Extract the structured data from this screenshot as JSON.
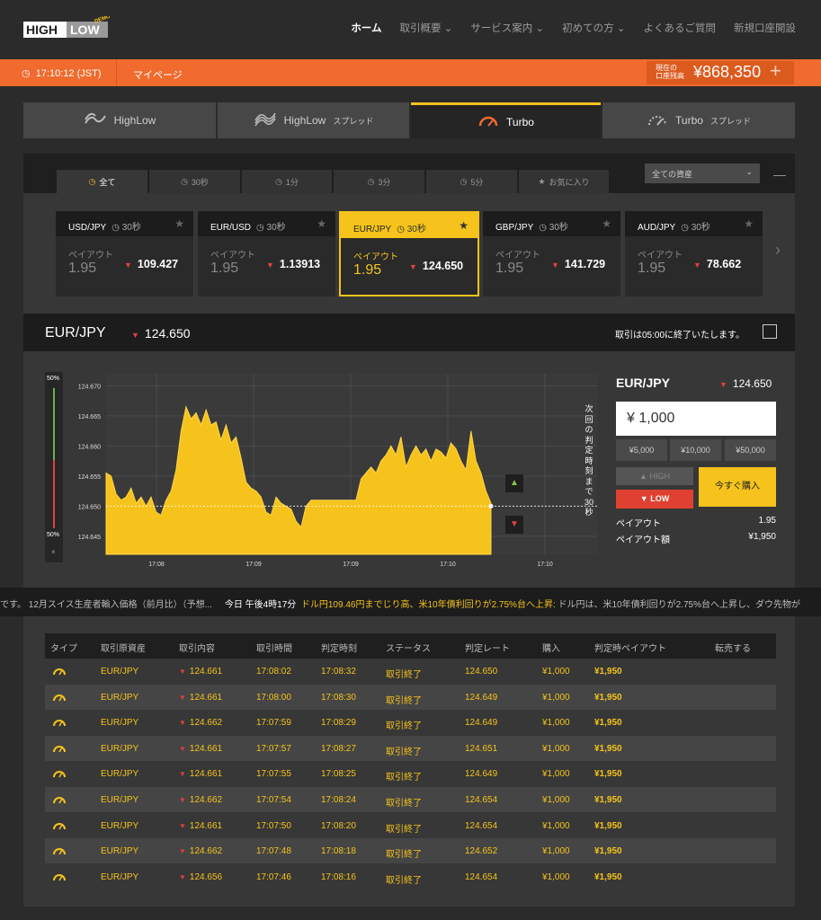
{
  "header": {
    "logo_text_1": "HIGH",
    "logo_text_2": "LOW",
    "logo_badge": "DEMO",
    "nav": [
      "ホーム",
      "取引概要",
      "サービス案内",
      "初めての方",
      "よくあるご質問",
      "新規口座開設"
    ]
  },
  "statusbar": {
    "clock": "17:10:12 (JST)",
    "mypage": "マイページ",
    "balance_label_1": "現在の",
    "balance_label_2": "口座残高",
    "balance": "¥868,350",
    "plus": "+"
  },
  "tabs": [
    {
      "label": "HighLow",
      "sub": ""
    },
    {
      "label": "HighLow",
      "sub": "スプレッド"
    },
    {
      "label": "Turbo",
      "sub": ""
    },
    {
      "label": "Turbo",
      "sub": "スプレッド"
    }
  ],
  "filters": [
    "全て",
    "30秒",
    "1分",
    "3分",
    "5分",
    "お気に入り"
  ],
  "asset_select": "全ての資産",
  "cards": [
    {
      "pair": "USD/JPY",
      "dur": "30秒",
      "payout_label": "ペイアウト",
      "payout": "1.95",
      "rate": "109.427"
    },
    {
      "pair": "EUR/USD",
      "dur": "30秒",
      "payout_label": "ペイアウト",
      "payout": "1.95",
      "rate": "1.13913"
    },
    {
      "pair": "EUR/JPY",
      "dur": "30秒",
      "payout_label": "ペイアウト",
      "payout": "1.95",
      "rate": "124.650"
    },
    {
      "pair": "GBP/JPY",
      "dur": "30秒",
      "payout_label": "ペイアウト",
      "payout": "1.95",
      "rate": "141.729"
    },
    {
      "pair": "AUD/JPY",
      "dur": "30秒",
      "payout_label": "ペイアウト",
      "payout": "1.95",
      "rate": "78.662"
    }
  ],
  "pairbar": {
    "pair": "EUR/JPY",
    "rate": "124.650",
    "close_msg": "取引は05:00に終了いたします。"
  },
  "gauge": {
    "top": "50%",
    "bottom": "50%",
    "x": "×"
  },
  "countdown": "次回の判定時刻まで30秒",
  "chart_data": {
    "type": "area",
    "x_ticks": [
      "17:08",
      "17:09",
      "17:09",
      "17:10",
      "17:10"
    ],
    "y_ticks": [
      "124.670",
      "124.665",
      "124.660",
      "124.655",
      "124.650",
      "124.645"
    ],
    "ylim": [
      124.642,
      124.672
    ],
    "current": 124.65,
    "color": "#f5c31b",
    "values": [
      124.6555,
      124.655,
      124.652,
      124.651,
      124.6515,
      124.653,
      124.6505,
      124.6515,
      124.65,
      124.6515,
      124.649,
      124.6485,
      124.651,
      124.6525,
      124.656,
      124.6625,
      124.6665,
      124.6645,
      124.6655,
      124.6635,
      124.666,
      124.6635,
      124.664,
      124.661,
      124.6635,
      124.6605,
      124.6615,
      124.658,
      124.654,
      124.653,
      124.6525,
      124.6515,
      124.649,
      124.6485,
      124.6515,
      124.6505,
      124.65,
      124.6495,
      124.6475,
      124.6465,
      124.65,
      124.651,
      124.651,
      124.651,
      124.651,
      124.651,
      124.651,
      124.651,
      124.651,
      124.651,
      124.651,
      124.6545,
      124.6555,
      124.6565,
      124.6555,
      124.6575,
      124.6585,
      124.66,
      124.6585,
      124.6615,
      124.6565,
      124.6585,
      124.66,
      124.6585,
      124.6595,
      124.6575,
      124.6595,
      124.659,
      124.658,
      124.6605,
      124.6595,
      124.6575,
      124.656,
      124.6625,
      124.6575,
      124.6555,
      124.6525,
      124.6505
    ]
  },
  "ticket": {
    "pair": "EUR/JPY",
    "rate": "124.650",
    "amount": "¥ 1,000",
    "quick": [
      "¥5,000",
      "¥10,000",
      "¥50,000"
    ],
    "high": "HIGH",
    "low": "LOW",
    "buy": "今すぐ購入",
    "payout_label": "ペイアウト",
    "payout": "1.95",
    "payout_amount_label": "ペイアウト額",
    "payout_amount": "¥1,950"
  },
  "ticker": {
    "pre": "です。 12月スイス生産者輸入価格（前月比）（予想...",
    "time": "今日 午後4時17分",
    "headline": "ドル円109.46円までじり高、米10年債利回りが2.75%台へ上昇:",
    "body": "ドル円は、米10年債利回りが2.75%台へ上昇し、ダウ先物が"
  },
  "history": {
    "headers": [
      "タイプ",
      "取引原資産",
      "取引内容",
      "取引時間",
      "判定時刻",
      "ステータス",
      "判定レート",
      "購入",
      "判定時ペイアウト",
      "転売する"
    ],
    "rows": [
      {
        "asset": "EUR/JPY",
        "strike": "124.661",
        "time": "17:08:02",
        "expiry": "17:08:32",
        "status": "取引終了",
        "close": "124.650",
        "amount": "¥1,000",
        "payout": "¥1,950"
      },
      {
        "asset": "EUR/JPY",
        "strike": "124.661",
        "time": "17:08:00",
        "expiry": "17:08:30",
        "status": "取引終了",
        "close": "124.649",
        "amount": "¥1,000",
        "payout": "¥1,950"
      },
      {
        "asset": "EUR/JPY",
        "strike": "124.662",
        "time": "17:07:59",
        "expiry": "17:08:29",
        "status": "取引終了",
        "close": "124.649",
        "amount": "¥1,000",
        "payout": "¥1,950"
      },
      {
        "asset": "EUR/JPY",
        "strike": "124.661",
        "time": "17:07:57",
        "expiry": "17:08:27",
        "status": "取引終了",
        "close": "124.651",
        "amount": "¥1,000",
        "payout": "¥1,950"
      },
      {
        "asset": "EUR/JPY",
        "strike": "124.661",
        "time": "17:07:55",
        "expiry": "17:08:25",
        "status": "取引終了",
        "close": "124.649",
        "amount": "¥1,000",
        "payout": "¥1,950"
      },
      {
        "asset": "EUR/JPY",
        "strike": "124.662",
        "time": "17:07:54",
        "expiry": "17:08:24",
        "status": "取引終了",
        "close": "124.654",
        "amount": "¥1,000",
        "payout": "¥1,950"
      },
      {
        "asset": "EUR/JPY",
        "strike": "124.661",
        "time": "17:07:50",
        "expiry": "17:08:20",
        "status": "取引終了",
        "close": "124.654",
        "amount": "¥1,000",
        "payout": "¥1,950"
      },
      {
        "asset": "EUR/JPY",
        "strike": "124.662",
        "time": "17:07:48",
        "expiry": "17:08:18",
        "status": "取引終了",
        "close": "124.652",
        "amount": "¥1,000",
        "payout": "¥1,950"
      },
      {
        "asset": "EUR/JPY",
        "strike": "124.656",
        "time": "17:07:46",
        "expiry": "17:08:16",
        "status": "取引終了",
        "close": "124.654",
        "amount": "¥1,000",
        "payout": "¥1,950"
      }
    ]
  }
}
